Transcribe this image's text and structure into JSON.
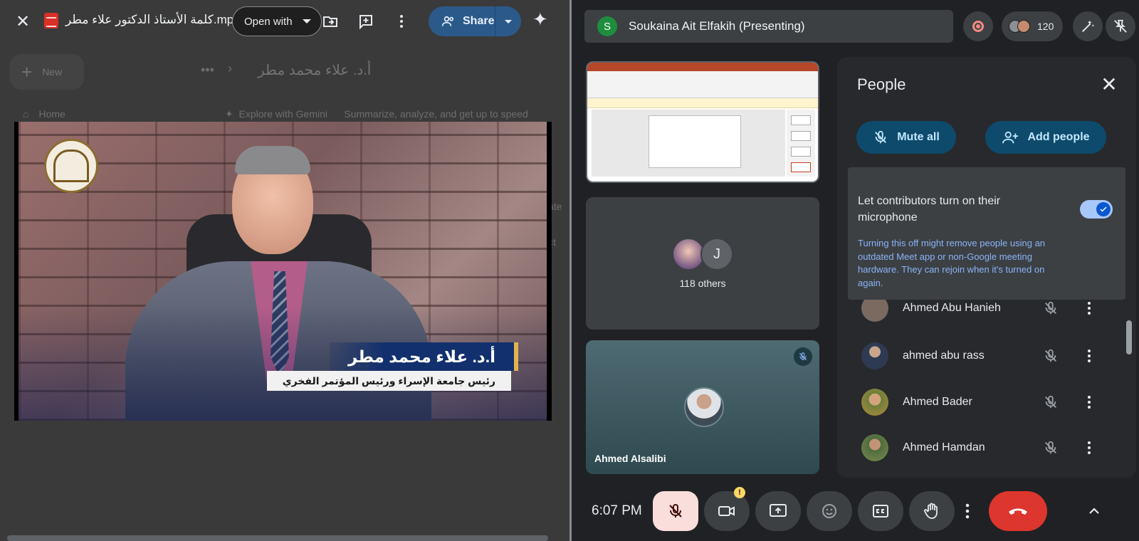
{
  "drive": {
    "file_name": "كلمة الأستاذ الدكتور علاء مطر.mp4",
    "open_with_label": "Open with",
    "share_label": "Share",
    "background": {
      "new_label": "New",
      "breadcrumb": "أ.د. علاء محمد مطر",
      "home_label": "Home",
      "explore_label": "Explore with Gemini",
      "summary_text": "Summarize, analyze, and get up to speed",
      "fragment_1": "ate",
      "fragment_2": "ct"
    },
    "video": {
      "name_caption": "أ.د. علاء محمد مطر",
      "title_caption": "رئيس جامعة الإسراء ورئيس المؤتمر الفخري"
    }
  },
  "meet": {
    "presenter_initial": "S",
    "presenter_label": "Soukaina Ait Elfakih (Presenting)",
    "participant_count": "120",
    "others_initial": "J",
    "others_label": "118 others",
    "featured_name": "Ahmed Alsalibi",
    "clock": "6:07 PM",
    "warning_badge": "!",
    "people_panel": {
      "title": "People",
      "mute_all_label": "Mute all",
      "add_people_label": "Add people",
      "setting_label": "Let contributors turn on their microphone",
      "setting_enabled": true,
      "setting_hint": "Turning this off might remove people using an outdated Meet app or non-Google meeting hardware. They can rejoin when it's turned on again.",
      "participants": [
        {
          "name": "Ahmed Abu Hanieh"
        },
        {
          "name": "ahmed abu rass"
        },
        {
          "name": "Ahmed Bader"
        },
        {
          "name": "Ahmed Hamdan"
        }
      ]
    },
    "colors": {
      "end_call": "#dc362e",
      "accent_button": "#0e4a6b",
      "accent_text": "#c2e7ff",
      "hint_text": "#8ab4f8"
    }
  }
}
